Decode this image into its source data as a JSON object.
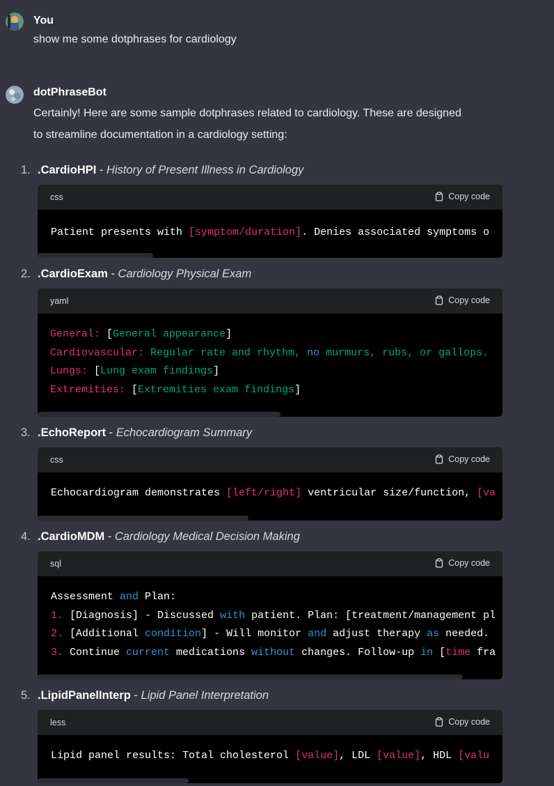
{
  "user": {
    "name": "You",
    "message": "show me some dotphrases for cardiology"
  },
  "bot": {
    "name": "dotPhraseBot",
    "intro_line1": "Certainly! Here are some sample dotphrases related to cardiology. These are designed",
    "intro_line2": "to streamline documentation in a cardiology setting:"
  },
  "copy_label": "Copy code",
  "items": [
    {
      "num": "1.",
      "name": ".CardioHPI",
      "sep": " - ",
      "desc": "History of Present Illness in Cardiology",
      "lang": "css"
    },
    {
      "num": "2.",
      "name": ".CardioExam",
      "sep": " - ",
      "desc": "Cardiology Physical Exam",
      "lang": "yaml"
    },
    {
      "num": "3.",
      "name": ".EchoReport",
      "sep": " - ",
      "desc": "Echocardiogram Summary",
      "lang": "css"
    },
    {
      "num": "4.",
      "name": ".CardioMDM",
      "sep": " - ",
      "desc": "Cardiology Medical Decision Making",
      "lang": "sql"
    },
    {
      "num": "5.",
      "name": ".LipidPanelInterp",
      "sep": " - ",
      "desc": "Lipid Panel Interpretation",
      "lang": "less"
    }
  ],
  "code": {
    "hpi": {
      "a": "Patient presents with ",
      "b": "[symptom/duration]",
      "c": ". Denies associated symptoms o"
    },
    "exam": {
      "l1a": "General:",
      "l1b": " [",
      "l1c": "General appearance",
      "l1d": "]",
      "l2a": "Cardiovascular:",
      "l2b": " Regular rate and rhythm, ",
      "l2c": "no",
      "l2d": " murmurs, rubs, or gallops.",
      "l3a": "Lungs:",
      "l3b": " [",
      "l3c": "Lung exam findings",
      "l3d": "]",
      "l4a": "Extremities:",
      "l4b": " [",
      "l4c": "Extremities exam findings",
      "l4d": "]"
    },
    "echo": {
      "a": "Echocardiogram demonstrates ",
      "b": "[left/right]",
      "c": " ventricular size/function, ",
      "d": "[va"
    },
    "mdm": {
      "l1a": "Assessment ",
      "l1b": "and",
      "l1c": " Plan:",
      "l2n": "1.",
      "l2a": " [Diagnosis] - Discussed ",
      "l2b": "with",
      "l2c": " patient. Plan: [treatment/management pl",
      "l3n": "2.",
      "l3a": " [Additional ",
      "l3b": "condition",
      "l3c": "] - Will monitor ",
      "l3d": "and",
      "l3e": " adjust therapy ",
      "l3f": "as",
      "l3g": " needed.",
      "l4n": "3.",
      "l4a": " Continue ",
      "l4b": "current",
      "l4c": " medications ",
      "l4d": "without",
      "l4e": " changes. Follow-up ",
      "l4f": "in",
      "l4g": " [",
      "l4h": "time",
      "l4i": " fra"
    },
    "lipid": {
      "a": "Lipid panel results: Total cholesterol ",
      "b": "[value]",
      "c": ", LDL ",
      "d": "[value]",
      "e": ", HDL ",
      "f": "[valu"
    }
  },
  "colors": {
    "background": "#343541",
    "code_bg": "#000000",
    "code_head": "#202123",
    "keyword_red": "#df3079",
    "string_green": "#00a67d",
    "keyword_blue": "#2e95d3"
  }
}
